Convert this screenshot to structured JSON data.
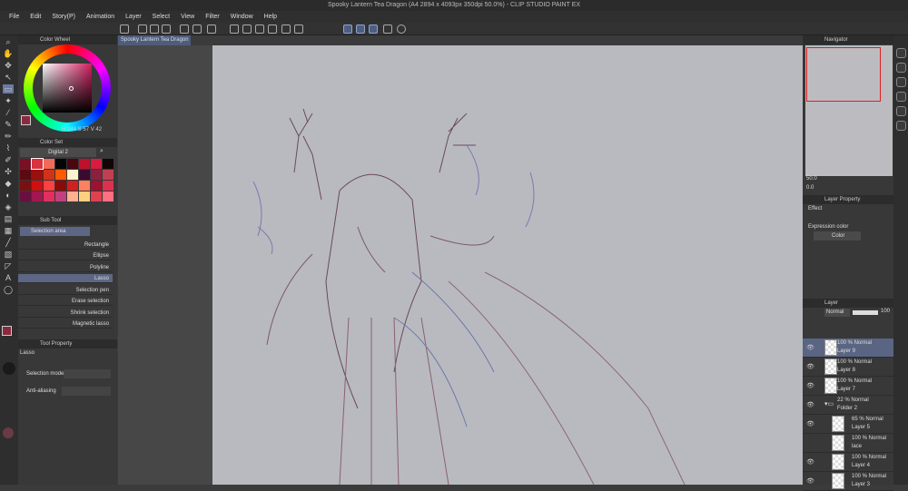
{
  "window": {
    "title": "Spooky Lantern Tea Dragon (A4 2894 x 4093px 350dpi 50.0%) - CLIP STUDIO PAINT EX"
  },
  "menu": [
    "File",
    "Edit",
    "Story(P)",
    "Animation",
    "Layer",
    "Select",
    "View",
    "Filter",
    "Window",
    "Help"
  ],
  "doc_tab": {
    "label": "Spooky Lantern Tea Dragon",
    "close": "×"
  },
  "color_wheel": {
    "title": "Color Wheel",
    "h": "344",
    "s": "57",
    "v": "42",
    "main_color": "#8a2a3e"
  },
  "color_set": {
    "title": "Color Set",
    "selected": "Digital 2",
    "swatches": [
      "#7a0f25",
      "#d9333f",
      "#f06a5a",
      "#050505",
      "#4b0710",
      "#c0102a",
      "#d81c40",
      "#120506",
      "#5a0a10",
      "#9a1010",
      "#d03318",
      "#ff5a00",
      "#fff0d0",
      "#3a0a30",
      "#8a2040",
      "#c04050",
      "#7a1010",
      "#d01010",
      "#ff4040",
      "#8a0a0a",
      "#d02020",
      "#ff8060",
      "#a01030",
      "#e03050",
      "#6a1040",
      "#a01850",
      "#e03060",
      "#c04080",
      "#ffb090",
      "#ffd080",
      "#e04050",
      "#ff7080"
    ]
  },
  "sub_tool": {
    "title": "Sub Tool",
    "group": "Selection area",
    "items": [
      "Rectangle",
      "Ellipse",
      "Polyline",
      "Lasso",
      "Selection pen",
      "Erase selection",
      "Shrink selection",
      "Magnetic lasso"
    ],
    "selected": "Lasso"
  },
  "tool_property": {
    "title": "Tool Property",
    "tool": "Lasso",
    "selection_mode_label": "Selection mode",
    "anti_aliasing_label": "Anti-aliasing"
  },
  "navigator": {
    "title": "Navigator",
    "zoom": "50.0",
    "rotation": "0.0"
  },
  "layer_property": {
    "title": "Layer Property",
    "effect_label": "Effect",
    "expression_color_label": "Expression color",
    "expression_color": "Color"
  },
  "layers_panel": {
    "title": "Layer",
    "blend": "Normal",
    "opacity": "100",
    "layers": [
      {
        "l1": "100 % Normal",
        "l2": "Layer 9",
        "selected": true,
        "visible": true,
        "indent": 0
      },
      {
        "l1": "100 % Normal",
        "l2": "Layer 8",
        "visible": true,
        "indent": 0
      },
      {
        "l1": "100 % Normal",
        "l2": "Layer 7",
        "visible": true,
        "indent": 0
      },
      {
        "l1": "22 % Normal",
        "l2": "Folder 2",
        "visible": true,
        "folder": true,
        "indent": 0
      },
      {
        "l1": "65 % Normal",
        "l2": "Layer 5",
        "visible": true,
        "indent": 1
      },
      {
        "l1": "100 % Normal",
        "l2": "lace",
        "visible": false,
        "indent": 1
      },
      {
        "l1": "100 % Normal",
        "l2": "Layer 4",
        "visible": true,
        "indent": 1
      },
      {
        "l1": "100 % Normal",
        "l2": "Layer 3",
        "visible": true,
        "indent": 1
      }
    ]
  }
}
